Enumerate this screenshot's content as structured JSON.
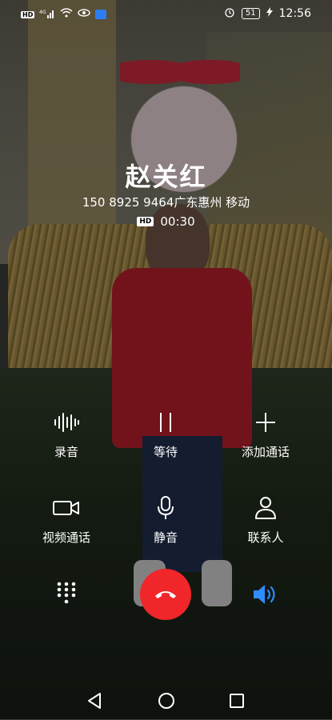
{
  "status_bar": {
    "time": "12:56",
    "battery": "51",
    "network_badge": "4G",
    "hd_label": "HD"
  },
  "call": {
    "caller_name": "赵关红",
    "number_location": "150 8925 9464广东惠州 移动",
    "hd_label": "HD",
    "duration": "00:30"
  },
  "controls": {
    "record": "录音",
    "hold": "等待",
    "add_call": "添加通话",
    "video_call": "视频通话",
    "mute": "静音",
    "contacts": "联系人"
  },
  "colors": {
    "end_call": "#f0262a",
    "speaker_active": "#2f8bff"
  }
}
